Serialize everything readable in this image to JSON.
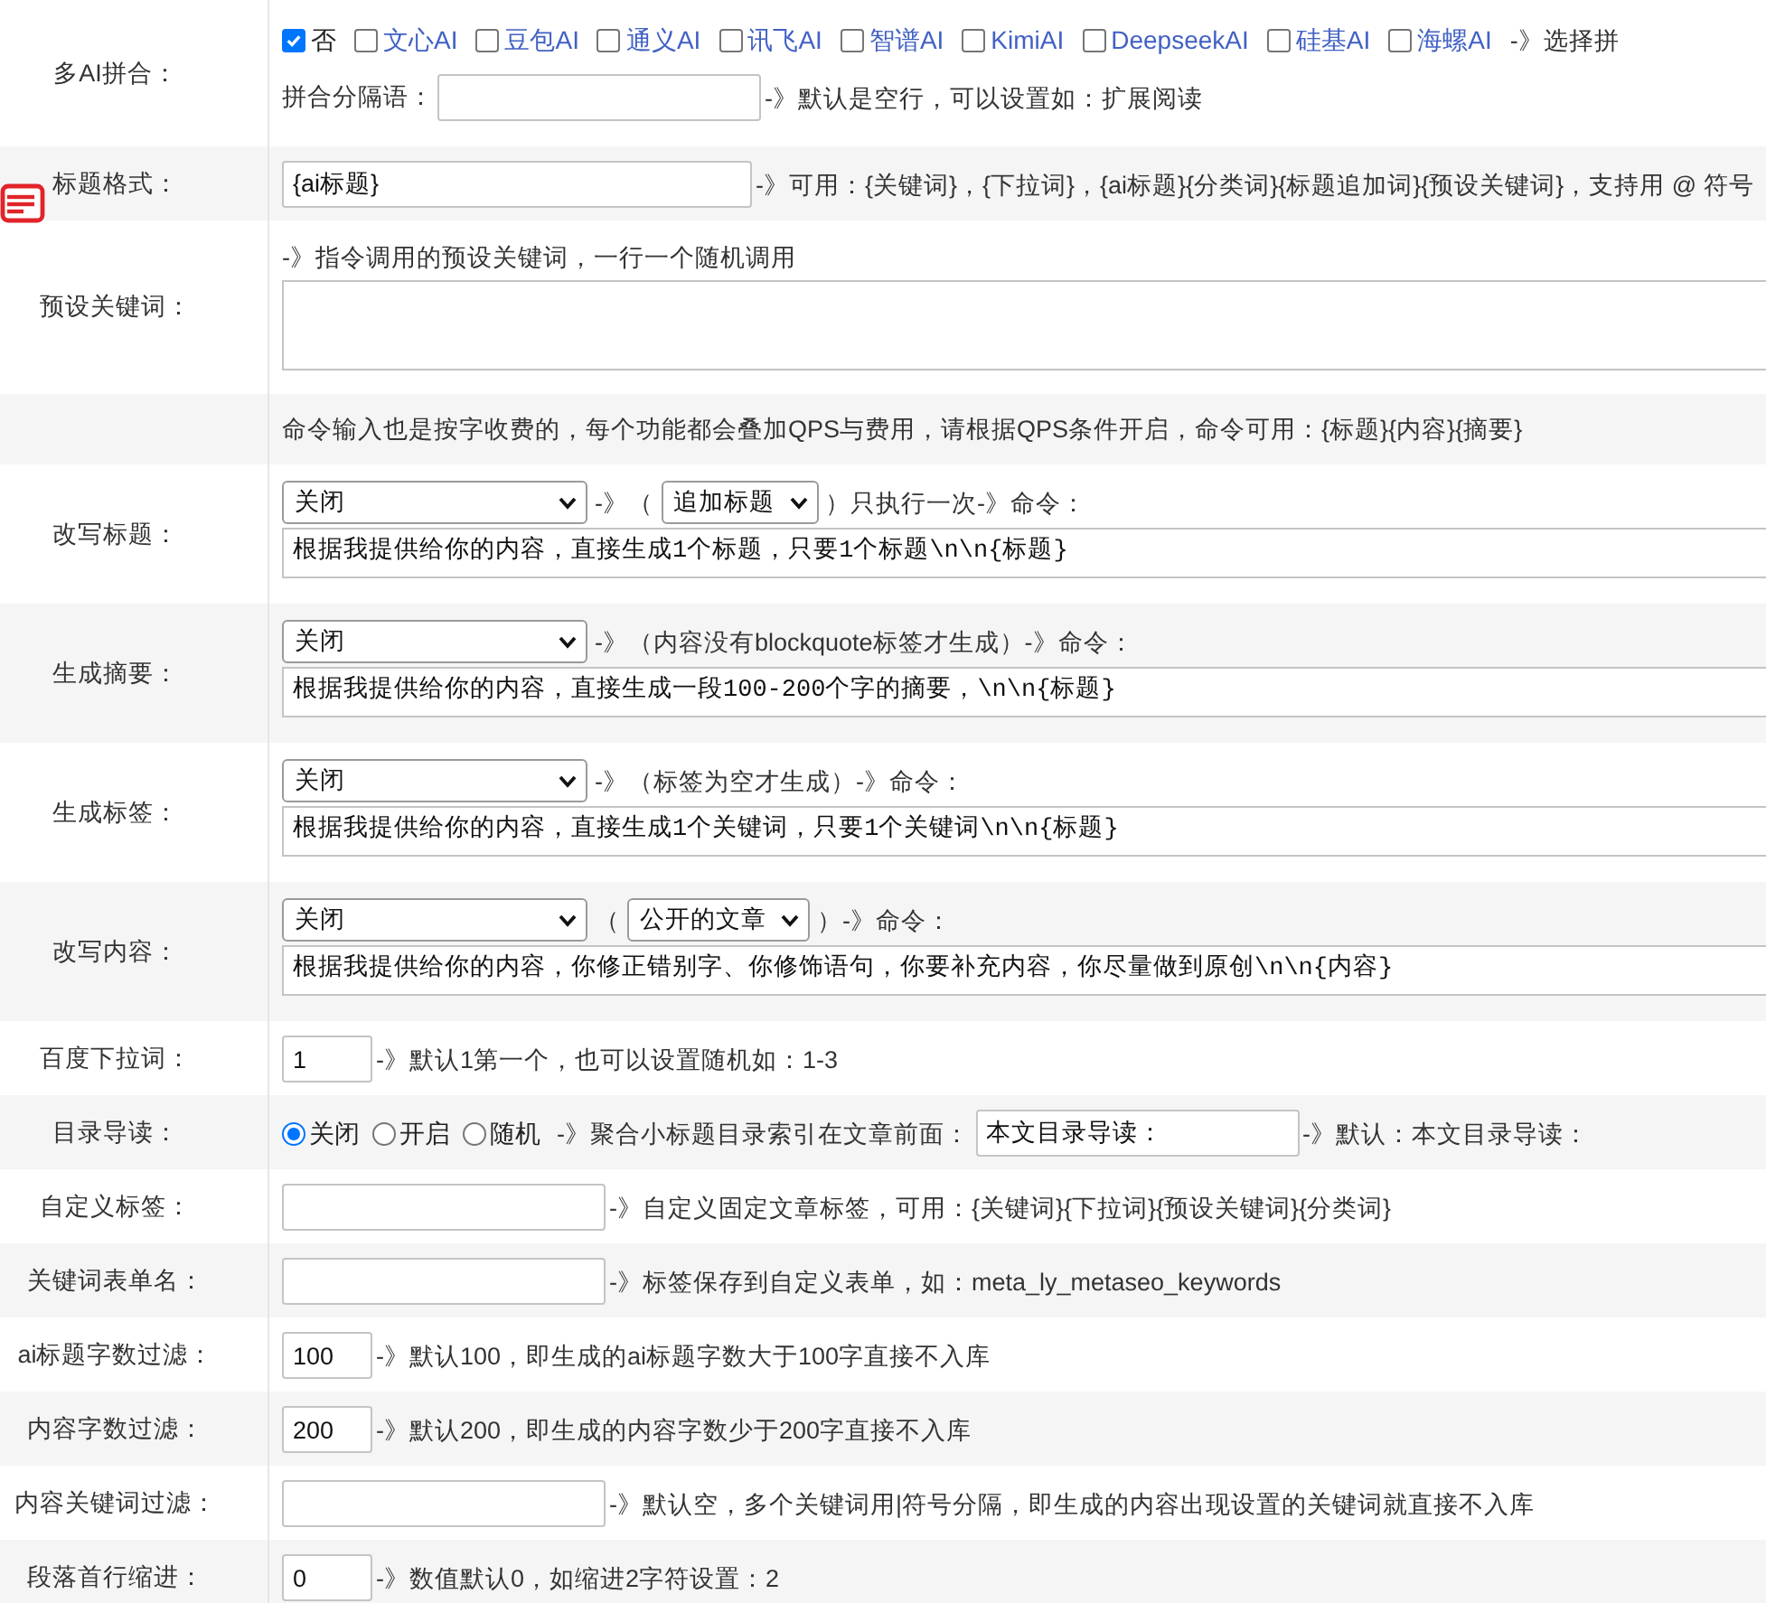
{
  "rows": [
    {
      "kind": "ai_merge",
      "label": "多AI拼合：",
      "options": [
        {
          "label": "否",
          "kind": "off",
          "checked": true
        },
        {
          "label": "文心AI",
          "kind": "model",
          "checked": false
        },
        {
          "label": "豆包AI",
          "kind": "model",
          "checked": false
        },
        {
          "label": "通义AI",
          "kind": "model",
          "checked": false
        },
        {
          "label": "讯飞AI",
          "kind": "model",
          "checked": false
        },
        {
          "label": "智谱AI",
          "kind": "model",
          "checked": false
        },
        {
          "label": "KimiAI",
          "kind": "model",
          "checked": false
        },
        {
          "label": "DeepseekAI",
          "kind": "model",
          "checked": false
        },
        {
          "label": "硅基AI",
          "kind": "model",
          "checked": false
        },
        {
          "label": "海螺AI",
          "kind": "model",
          "checked": false
        }
      ],
      "note": "-》选择拼",
      "separator": {
        "label": "拼合分隔语：",
        "field": {
          "kind": "text"
        },
        "hint": "-》默认是空行，可以设置如：扩展阅读"
      }
    },
    {
      "kind": "field",
      "label": "标题格式：",
      "field": {
        "kind": "format",
        "value": "{ai标题}"
      },
      "hint": "-》可用：{关键词}，{下拉词}，{ai标题}{分类词}{标题追加词}{预设关键词}，支持用 @ 符号"
    },
    {
      "kind": "textarea",
      "label": "预设关键词：",
      "hint": "-》指令调用的预设关键词，一行一个随机调用"
    },
    {
      "kind": "notice",
      "text": "命令输入也是按字收费的，每个功能都会叠加QPS与费用，请根据QPS条件开启，命令可用：{标题}{内容}{摘要}"
    },
    {
      "kind": "command",
      "label": "改写标题：",
      "parts": [
        {
          "kind": "select",
          "value": "关闭"
        },
        {
          "kind": "text",
          "text": "-》（"
        },
        {
          "kind": "select",
          "value": "追加标题"
        },
        {
          "kind": "text",
          "text": "）只执行一次-》命令："
        }
      ],
      "command": "根据我提供给你的内容，直接生成1个标题，只要1个标题\\n\\n{标题}"
    },
    {
      "kind": "command",
      "label": "生成摘要：",
      "parts": [
        {
          "kind": "select",
          "value": "关闭"
        },
        {
          "kind": "text",
          "text": "-》（内容没有blockquote标签才生成）-》命令："
        }
      ],
      "command": "根据我提供给你的内容，直接生成一段100-200个字的摘要，\\n\\n{标题}"
    },
    {
      "kind": "command",
      "label": "生成标签：",
      "parts": [
        {
          "kind": "select",
          "value": "关闭"
        },
        {
          "kind": "text",
          "text": "-》（标签为空才生成）-》命令："
        }
      ],
      "command": "根据我提供给你的内容，直接生成1个关键词，只要1个关键词\\n\\n{标题}"
    },
    {
      "kind": "command",
      "label": "改写内容：",
      "parts": [
        {
          "kind": "select",
          "value": "关闭"
        },
        {
          "kind": "text",
          "text": "（"
        },
        {
          "kind": "select",
          "value": "公开的文章"
        },
        {
          "kind": "text",
          "text": "）-》命令："
        }
      ],
      "command": "根据我提供给你的内容，你修正错别字、你修饰语句，你要补充内容，你尽量做到原创\\n\\n{内容}"
    },
    {
      "kind": "field",
      "label": "百度下拉词：",
      "field": {
        "kind": "number",
        "value": "1"
      },
      "hint": "-》默认1第一个，也可以设置随机如：1-3"
    },
    {
      "kind": "radio",
      "label": "目录导读：",
      "options": [
        {
          "label": "关闭",
          "selected": true
        },
        {
          "label": "开启",
          "selected": false
        },
        {
          "label": "随机",
          "selected": false
        }
      ],
      "text": "-》聚合小标题目录索引在文章前面：",
      "field": {
        "kind": "text",
        "value": "本文目录导读："
      },
      "hint": "-》默认：本文目录导读："
    },
    {
      "kind": "field",
      "label": "自定义标签：",
      "field": {
        "kind": "text"
      },
      "hint": "-》自定义固定文章标签，可用：{关键词}{下拉词}{预设关键词}{分类词}"
    },
    {
      "kind": "field",
      "label": "关键词表单名：",
      "field": {
        "kind": "text"
      },
      "hint": "-》标签保存到自定义表单，如：meta_ly_metaseo_keywords"
    },
    {
      "kind": "field",
      "label": "ai标题字数过滤：",
      "field": {
        "kind": "number",
        "value": "100"
      },
      "hint": "-》默认100，即生成的ai标题字数大于100字直接不入库"
    },
    {
      "kind": "field",
      "label": "内容字数过滤：",
      "field": {
        "kind": "number",
        "value": "200"
      },
      "hint": "-》默认200，即生成的内容字数少于200字直接不入库"
    },
    {
      "kind": "field",
      "label": "内容关键词过滤：",
      "field": {
        "kind": "text"
      },
      "hint": "-》默认空，多个关键词用|符号分隔，即生成的内容出现设置的关键词就直接不入库"
    },
    {
      "kind": "field",
      "label": "段落首行缩进：",
      "field": {
        "kind": "number",
        "value": "0"
      },
      "hint": "-》数值默认0，如缩进2字符设置：2"
    }
  ]
}
